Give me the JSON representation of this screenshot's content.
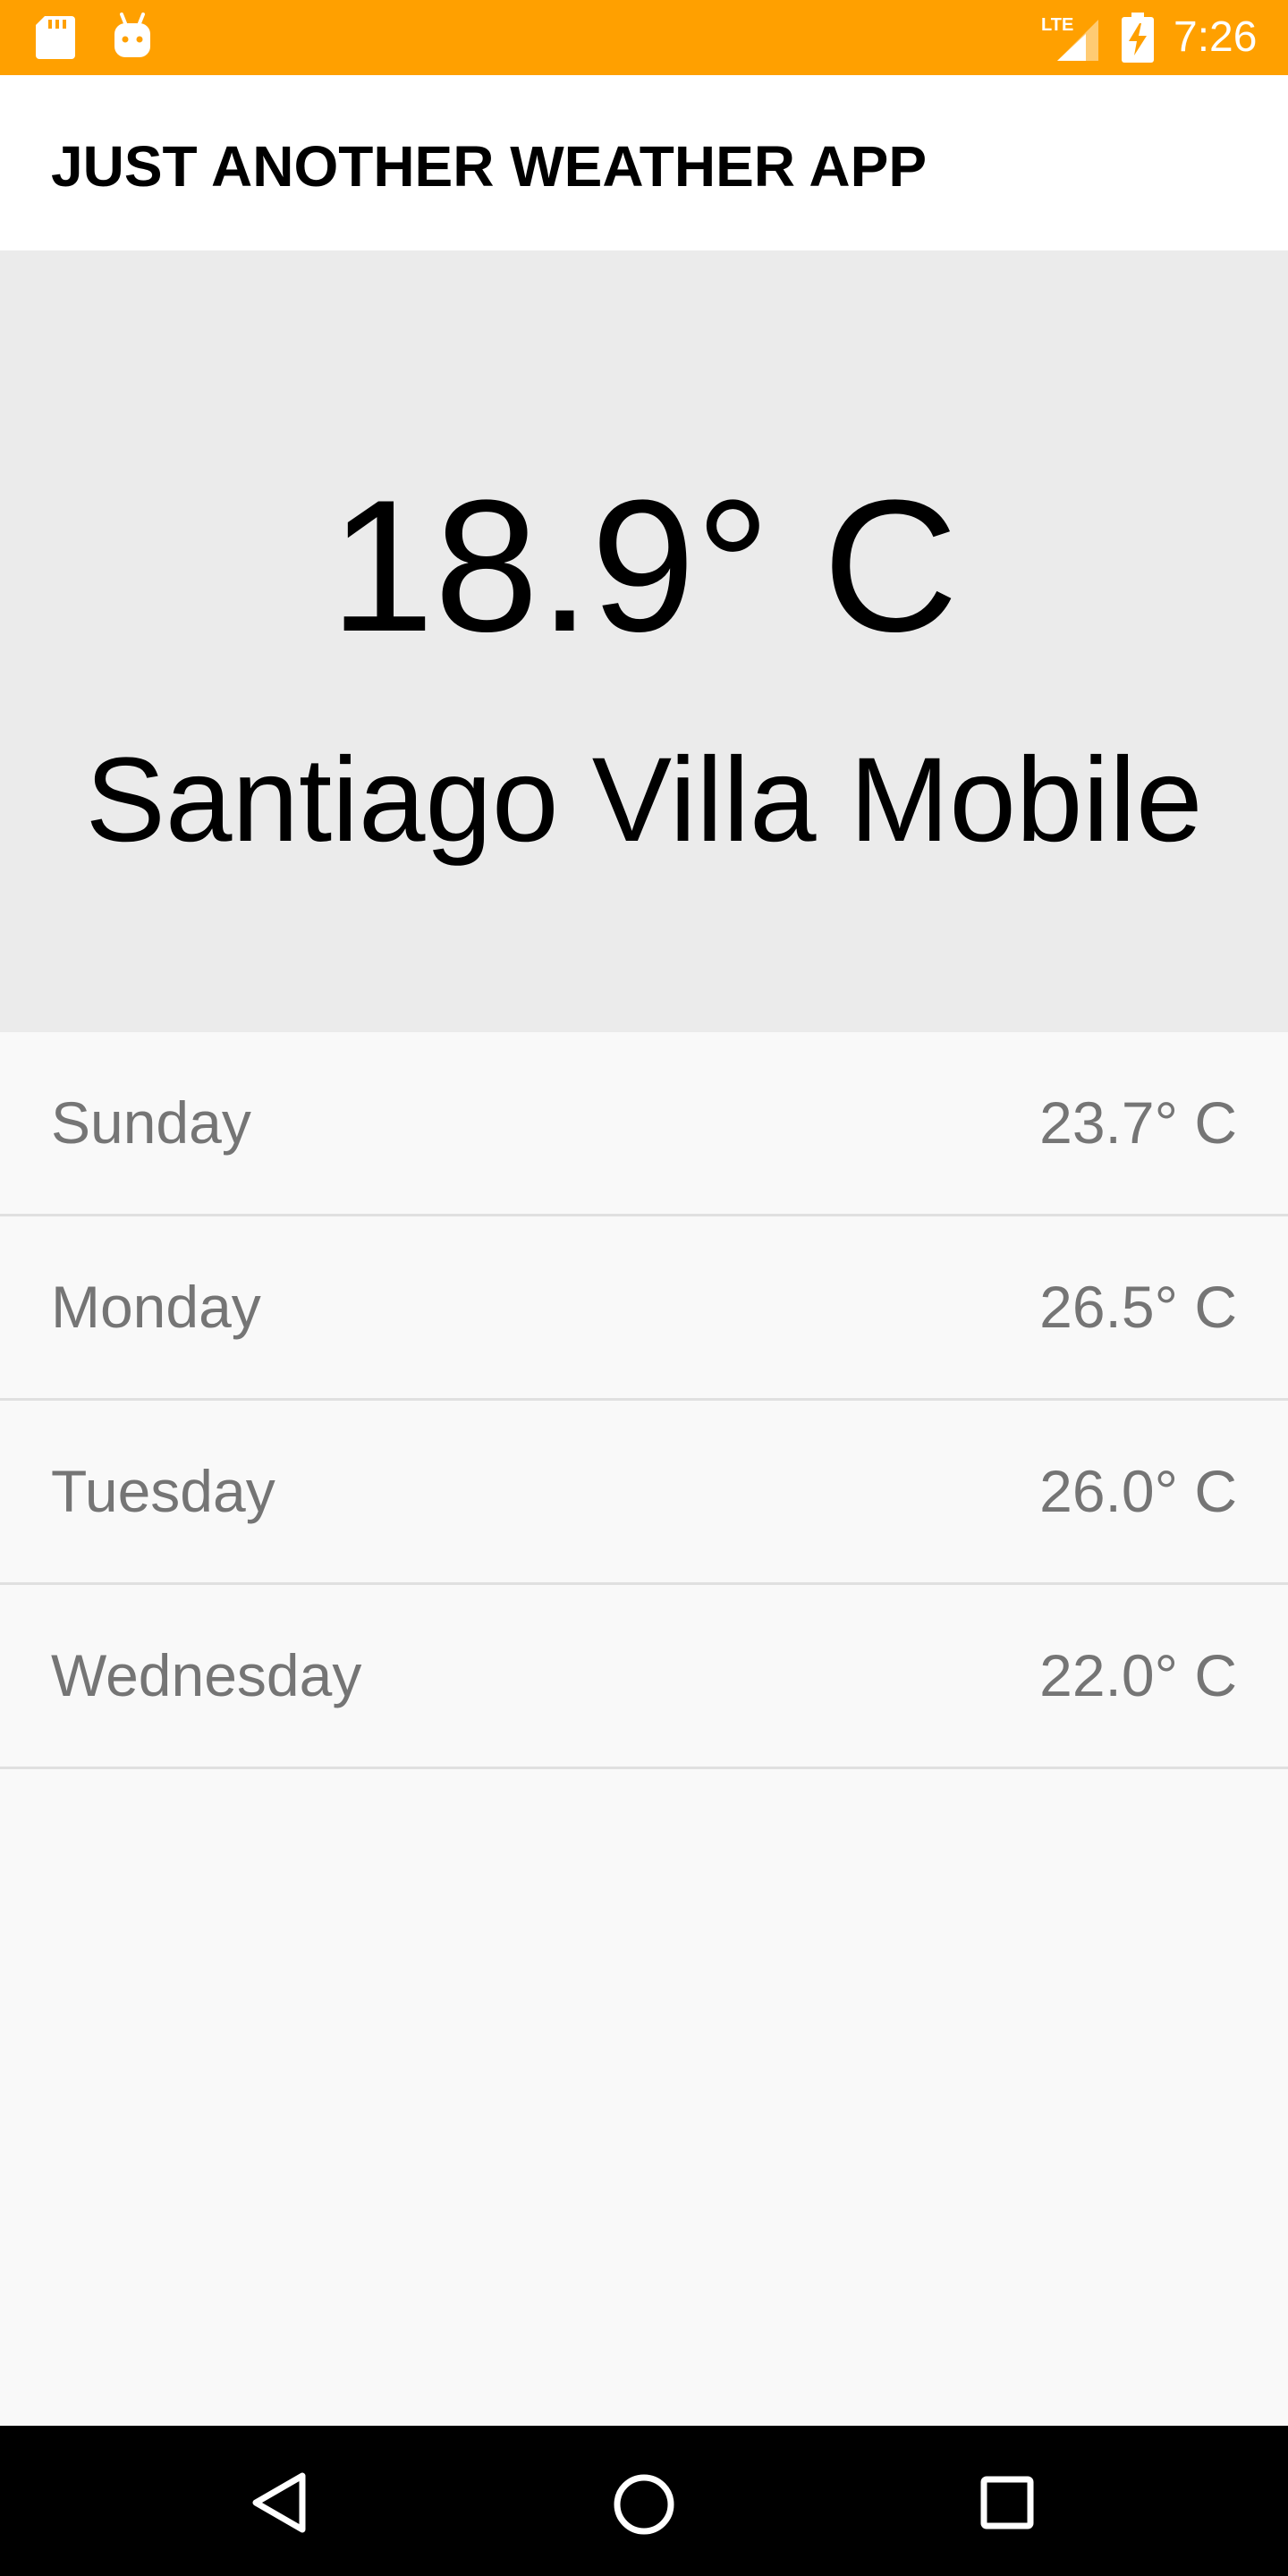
{
  "status_bar": {
    "time": "7:26",
    "icons": [
      "sd-card-icon",
      "android-icon",
      "lte-signal-icon",
      "battery-charging-icon"
    ],
    "lte_label": "LTE",
    "background_color": "#ffa000"
  },
  "app_bar": {
    "title": "JUST ANOTHER WEATHER APP"
  },
  "current": {
    "temperature": "18.9° C",
    "city": "Santiago Villa Mobile"
  },
  "forecast": [
    {
      "day": "Sunday",
      "temperature": "23.7° C"
    },
    {
      "day": "Monday",
      "temperature": "26.5° C"
    },
    {
      "day": "Tuesday",
      "temperature": "26.0° C"
    },
    {
      "day": "Wednesday",
      "temperature": "22.0° C"
    }
  ],
  "nav_bar": {
    "icons": [
      "back-icon",
      "home-icon",
      "recents-icon"
    ]
  }
}
